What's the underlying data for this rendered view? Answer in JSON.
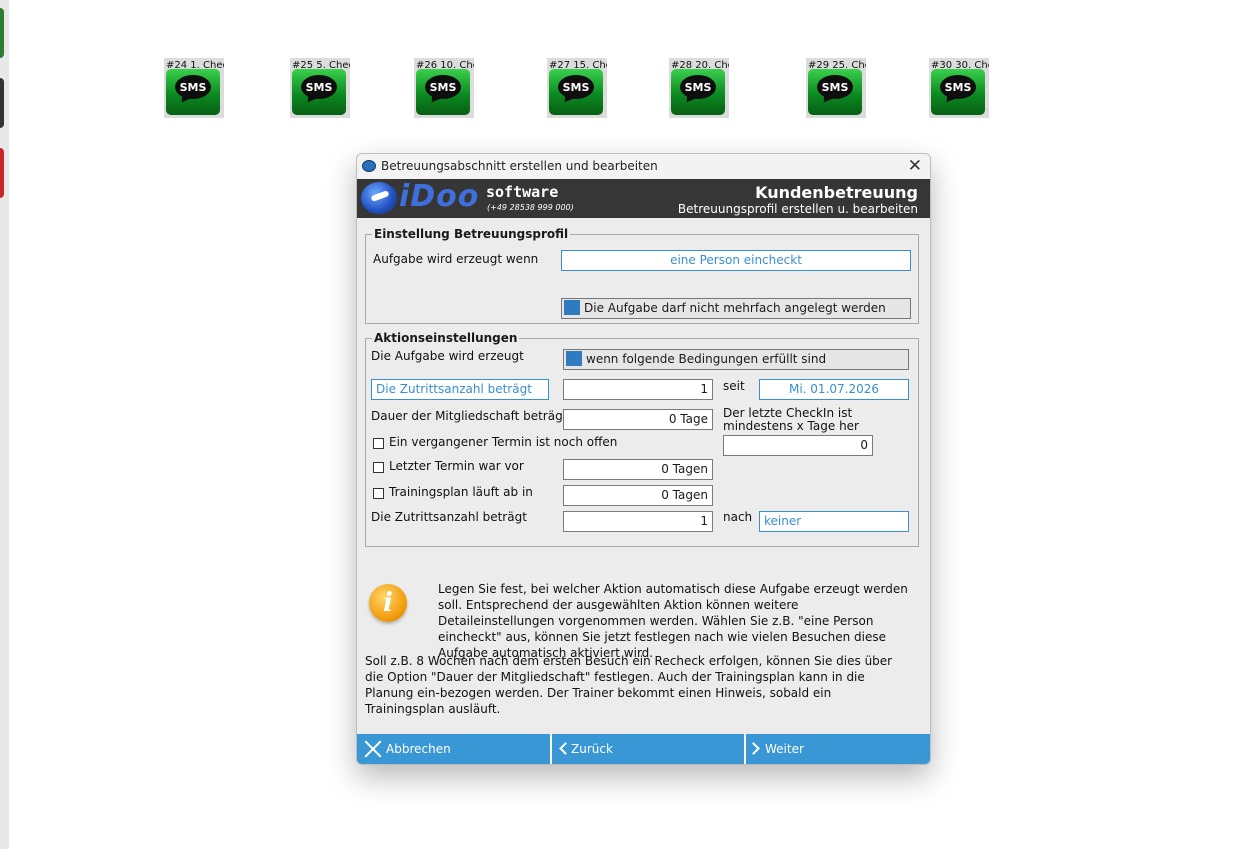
{
  "desktop": {
    "sms_tiles": [
      {
        "caption": "#24 1. Chec",
        "badge": "SMS"
      },
      {
        "caption": "#25 5. Chec",
        "badge": "SMS"
      },
      {
        "caption": "#26 10. Che",
        "badge": "SMS"
      },
      {
        "caption": "#27 15. Che",
        "badge": "SMS"
      },
      {
        "caption": "#28 20. Che",
        "badge": "SMS"
      },
      {
        "caption": "#29 25. Che",
        "badge": "SMS"
      },
      {
        "caption": "#30 30. Che",
        "badge": "SMS"
      }
    ]
  },
  "dialog": {
    "title": "Betreuungsabschnitt erstellen und bearbeiten",
    "close_label": "✕",
    "banner": {
      "logo": "iDoo",
      "software": "software",
      "phone": "(+49 28538 999 000)",
      "title": "Kundenbetreuung",
      "subtitle": "Betreuungsprofil erstellen u. bearbeiten"
    },
    "profile_group": {
      "legend": "Einstellung Betreuungsprofil",
      "trigger_label": "Aufgabe wird erzeugt wenn",
      "trigger_value": "eine Person eincheckt",
      "no_duplicate_label": "Die Aufgabe darf nicht mehrfach angelegt werden"
    },
    "action_group": {
      "legend": "Aktionseinstellungen",
      "created_label": "Die Aufgabe wird erzeugt",
      "condition_label": "wenn folgende Bedingungen erfüllt sind",
      "access_count_select": "Die Zutrittsanzahl beträgt",
      "access_count_value": "1",
      "since_label": "seit",
      "since_date": "Mi. 01.07.2026",
      "membership_label": "Dauer der Mitgliedschaft beträgt",
      "membership_value": "0 Tage",
      "last_checkin_label": "Der letzte CheckIn ist mindestens x Tage her",
      "last_checkin_value": "0",
      "open_appointment_label": "Ein vergangener Termin ist noch offen",
      "last_appointment_label": "Letzter Termin war vor",
      "last_appointment_value": "0 Tagen",
      "training_plan_label": "Trainingsplan läuft ab in",
      "training_plan_value": "0 Tagen",
      "access_count2_label": "Die Zutrittsanzahl beträgt",
      "access_count2_value": "1",
      "after_label": "nach",
      "after_value": "keiner"
    },
    "info": {
      "icon": "info-icon",
      "text1": "Legen Sie fest, bei welcher Aktion automatisch diese Aufgabe erzeugt werden soll. Entsprechend der ausgewählten Aktion können weitere Detaileinstellungen vorgenommen werden. Wählen Sie z.B. \"eine Person eincheckt\" aus, können Sie jetzt festlegen nach wie vielen Besuchen diese Aufgabe automatisch aktiviert wird.",
      "text2": "Soll z.B. 8 Wochen nach dem ersten Besuch ein Recheck erfolgen, können Sie dies über die Option \"Dauer der Mitgliedschaft\" festlegen. Auch der Trainingsplan kann in die Planung ein-bezogen werden. Der Trainer bekommt einen Hinweis, sobald ein Trainingsplan ausläuft."
    },
    "footer": {
      "cancel": "Abbrechen",
      "back": "Zurück",
      "next": "Weiter"
    },
    "colors": {
      "accent": "#3a97d5",
      "banner": "#363636",
      "flag": "#2f7bbf"
    }
  }
}
